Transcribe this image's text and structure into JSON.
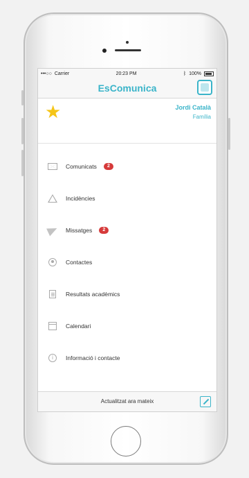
{
  "status_bar": {
    "signal": "•••○○",
    "carrier": "Carrier",
    "time": "20:23 PM",
    "battery": "100%"
  },
  "header": {
    "title": "EsComunica",
    "chat_icon": "chat-bubble-icon"
  },
  "profile": {
    "icon": "star-icon",
    "name": "Jordi Català",
    "role": "Família"
  },
  "menu": [
    {
      "label": "Comunicats",
      "icon": "envelope-icon",
      "badge": "2"
    },
    {
      "label": "Incidències",
      "icon": "warning-icon"
    },
    {
      "label": "Missatges",
      "icon": "send-icon",
      "badge": "2"
    },
    {
      "label": "Contactes",
      "icon": "contact-icon"
    },
    {
      "label": "Resultats acadèmics",
      "icon": "document-icon"
    },
    {
      "label": "Calendari",
      "icon": "calendar-icon"
    },
    {
      "label": "Informació i contacte",
      "icon": "info-icon"
    }
  ],
  "footer": {
    "refresh_label": "Actualitzat ara mateix",
    "compose_icon": "compose-icon"
  },
  "colors": {
    "accent": "#3ab4c9",
    "badge": "#d63a3a",
    "star": "#f5c518"
  }
}
